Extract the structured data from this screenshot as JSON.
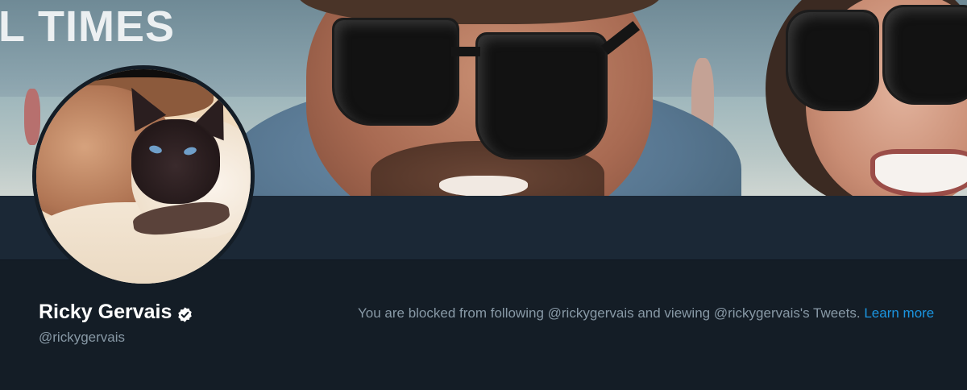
{
  "banner": {
    "text": "L TIMES",
    "icon": "header-photo"
  },
  "profile": {
    "avatar_icon": "profile-avatar",
    "name": "Ricky Gervais",
    "verified_icon": "verified-badge-icon",
    "handle": "@rickygervais"
  },
  "blocked": {
    "message": "You are blocked from following @rickygervais and viewing @rickygervais's Tweets.",
    "learn_more": "Learn more"
  },
  "colors": {
    "background": "#141d26",
    "nav_bar": "#1b2836",
    "name_text": "#ffffff",
    "secondary_text": "#8899a6",
    "link": "#1b95e0"
  }
}
